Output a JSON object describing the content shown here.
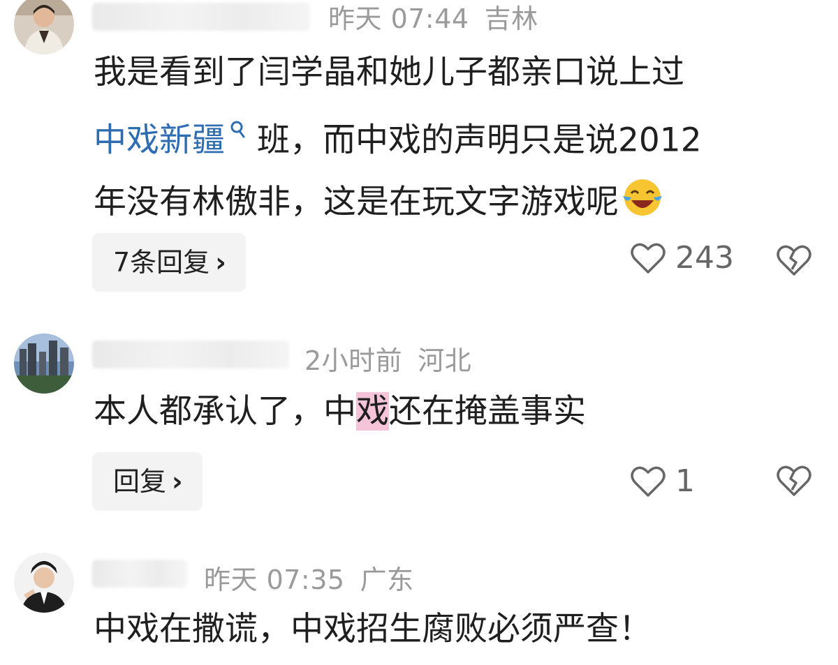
{
  "comments": [
    {
      "meta": {
        "time": "昨天 07:44",
        "location": "吉林"
      },
      "text": {
        "line1": "我是看到了闫学晶和她儿子都亲口说上过",
        "link": "中戏新疆",
        "line2_rest": "班，而中戏的声明只是说2012",
        "line3": "年没有林傲非，这是在玩文字游戏呢"
      },
      "emoji": "laughing-crying-emoji",
      "reply_label": "7条回复",
      "likes": "243"
    },
    {
      "meta": {
        "time": "2小时前",
        "location": "河北"
      },
      "text": {
        "part1": "本人都承认了，中",
        "highlight": "戏",
        "part2": "还在掩盖事实"
      },
      "reply_label": "回复",
      "likes": "1"
    },
    {
      "meta": {
        "time": "昨天 07:35",
        "location": "广东"
      },
      "text": {
        "line1": "中戏在撒谎，中戏招生腐败必须严查！"
      }
    }
  ],
  "icons": {
    "search": "search-icon",
    "like": "heart-icon",
    "dislike": "broken-heart-icon",
    "chevron": "chevron-right-icon"
  },
  "colors": {
    "link": "#2f6db3",
    "highlight": "#f6c4d8",
    "meta": "#9a9a9a"
  }
}
